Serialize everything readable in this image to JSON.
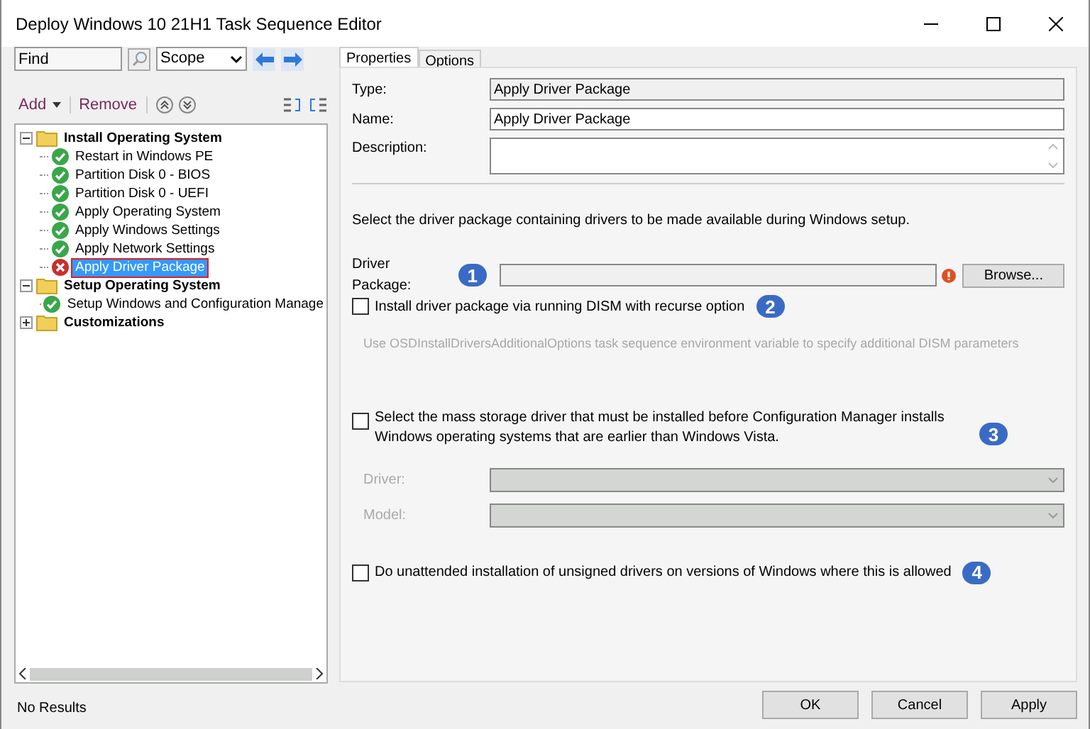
{
  "window": {
    "title": "Deploy Windows 10 21H1 Task Sequence Editor"
  },
  "search": {
    "placeholder": "Find",
    "scope": "Scope"
  },
  "toolbar": {
    "add": "Add",
    "remove": "Remove"
  },
  "tree": [
    {
      "label": "Install Operating System",
      "expanded": true,
      "selected": false,
      "children": [
        {
          "label": "Restart in Windows PE",
          "selected": false,
          "error": false
        },
        {
          "label": "Partition Disk 0 - BIOS",
          "selected": false,
          "error": false
        },
        {
          "label": "Partition Disk 0 - UEFI",
          "selected": false,
          "error": false
        },
        {
          "label": "Apply Operating System",
          "selected": false,
          "error": false
        },
        {
          "label": "Apply Windows Settings",
          "selected": false,
          "error": false
        },
        {
          "label": "Apply Network Settings",
          "selected": false,
          "error": false
        },
        {
          "label": "Apply Driver Package",
          "selected": true,
          "error": true
        }
      ]
    },
    {
      "label": "Setup Operating System",
      "expanded": true,
      "selected": false,
      "children": [
        {
          "label": "Setup Windows and Configuration Manage",
          "selected": false,
          "error": false
        }
      ]
    },
    {
      "label": "Customizations",
      "expanded": false,
      "selected": false
    }
  ],
  "status_bar": "No Results",
  "tabs": [
    {
      "label": "Properties",
      "selected": true
    },
    {
      "label": "Options",
      "selected": false
    }
  ],
  "properties": {
    "type_label": "Type:",
    "type_value": "Apply Driver Package",
    "name_label": "Name:",
    "name_value": "Apply Driver Package",
    "description_label": "Description:"
  },
  "intro": "Select the driver package containing drivers to be made available during Windows setup.",
  "driver_package": {
    "label": "Driver Package:",
    "callout": "1",
    "error": true,
    "browse": "Browse..."
  },
  "options": [
    {
      "label": "Install driver package via running DISM with recurse option",
      "checked": false,
      "callout": "2"
    },
    {
      "label": "Select the mass storage driver that must be installed before Configuration Manager installs Windows operating systems that are earlier than Windows Vista.",
      "checked": false,
      "callout": "3"
    }
  ],
  "hint": "Use OSDInstallDriversAdditionalOptions task sequence environment variable to specify additional DISM parameters",
  "mass_storage": [
    {
      "label": "Driver:",
      "disabled": true
    },
    {
      "label": "Model:",
      "disabled": true
    }
  ],
  "unsigned": {
    "label": "Do unattended installation of unsigned drivers on versions of Windows where this is allowed",
    "checked": false,
    "callout": "4"
  },
  "buttons": [
    "OK",
    "Cancel",
    "Apply"
  ]
}
